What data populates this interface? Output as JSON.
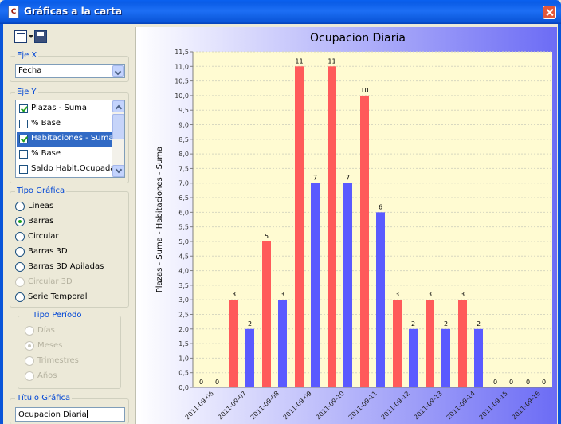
{
  "window": {
    "title": "Gráficas a la carta",
    "icon_letter": "C"
  },
  "toolbar": {
    "buttons": [
      "window-menu-icon",
      "save-icon"
    ]
  },
  "eje_x": {
    "legend": "Eje X",
    "selected": "Fecha"
  },
  "eje_y": {
    "legend": "Eje Y",
    "items": [
      {
        "label": "Plazas - Suma",
        "checked": true,
        "selected": false
      },
      {
        "label": "% Base",
        "checked": false,
        "selected": false
      },
      {
        "label": "Habitaciones - Suma",
        "checked": true,
        "selected": true
      },
      {
        "label": "% Base",
        "checked": false,
        "selected": false
      },
      {
        "label": "Saldo Habit.Ocupadas",
        "checked": false,
        "selected": false
      }
    ]
  },
  "tipo_grafica": {
    "legend": "Tipo Gráfica",
    "options": [
      {
        "label": "Lineas",
        "checked": false,
        "enabled": true
      },
      {
        "label": "Barras",
        "checked": true,
        "enabled": true
      },
      {
        "label": "Circular",
        "checked": false,
        "enabled": true
      },
      {
        "label": "Barras 3D",
        "checked": false,
        "enabled": true
      },
      {
        "label": "Barras 3D Apiladas",
        "checked": false,
        "enabled": true
      },
      {
        "label": "Circular 3D",
        "checked": false,
        "enabled": false
      },
      {
        "label": "Serie Temporal",
        "checked": false,
        "enabled": true
      }
    ]
  },
  "tipo_periodo": {
    "legend": "Tipo Período",
    "options": [
      {
        "label": "Días",
        "checked": false,
        "enabled": false
      },
      {
        "label": "Meses",
        "checked": true,
        "enabled": false
      },
      {
        "label": "Trimestres",
        "checked": false,
        "enabled": false
      },
      {
        "label": "Años",
        "checked": false,
        "enabled": false
      }
    ]
  },
  "titulo_grafica": {
    "legend": "Título Gráfica",
    "value": "Ocupacion Diaria"
  },
  "colors": {
    "series_red": "#ff5a5a",
    "series_blue": "#5a5aff",
    "plot_bg": "#fffbd2",
    "header_start": "#ffffff",
    "header_end": "#6c6cf5"
  },
  "chart_data": {
    "type": "bar",
    "title": "Ocupacion Diaria",
    "ylabel": "Plazas - Suma - Habitaciones - Suma",
    "xlabel": "",
    "ylim": [
      0,
      11.5
    ],
    "yticks": [
      "0,0",
      "0,5",
      "1,0",
      "1,5",
      "2,0",
      "2,5",
      "3,0",
      "3,5",
      "4,0",
      "4,5",
      "5,0",
      "5,5",
      "6,0",
      "6,5",
      "7,0",
      "7,5",
      "8,0",
      "8,5",
      "9,0",
      "9,5",
      "10,0",
      "10,5",
      "11,0",
      "11,5"
    ],
    "categories": [
      "2011-09-06",
      "2011-09-07",
      "2011-09-08",
      "2011-09-09",
      "2011-09-10",
      "2011-09-11",
      "2011-09-12",
      "2011-09-13",
      "2011-09-14",
      "2011-09-15",
      "2011-09-16"
    ],
    "series": [
      {
        "color": "#ff5a5a",
        "values": [
          0,
          3,
          5,
          11,
          11,
          10,
          3,
          3,
          3,
          0,
          0
        ]
      },
      {
        "color": "#5a5aff",
        "values": [
          0,
          2,
          3,
          7,
          7,
          6,
          2,
          2,
          2,
          0,
          0
        ]
      }
    ],
    "grid": true,
    "legend": "none"
  }
}
